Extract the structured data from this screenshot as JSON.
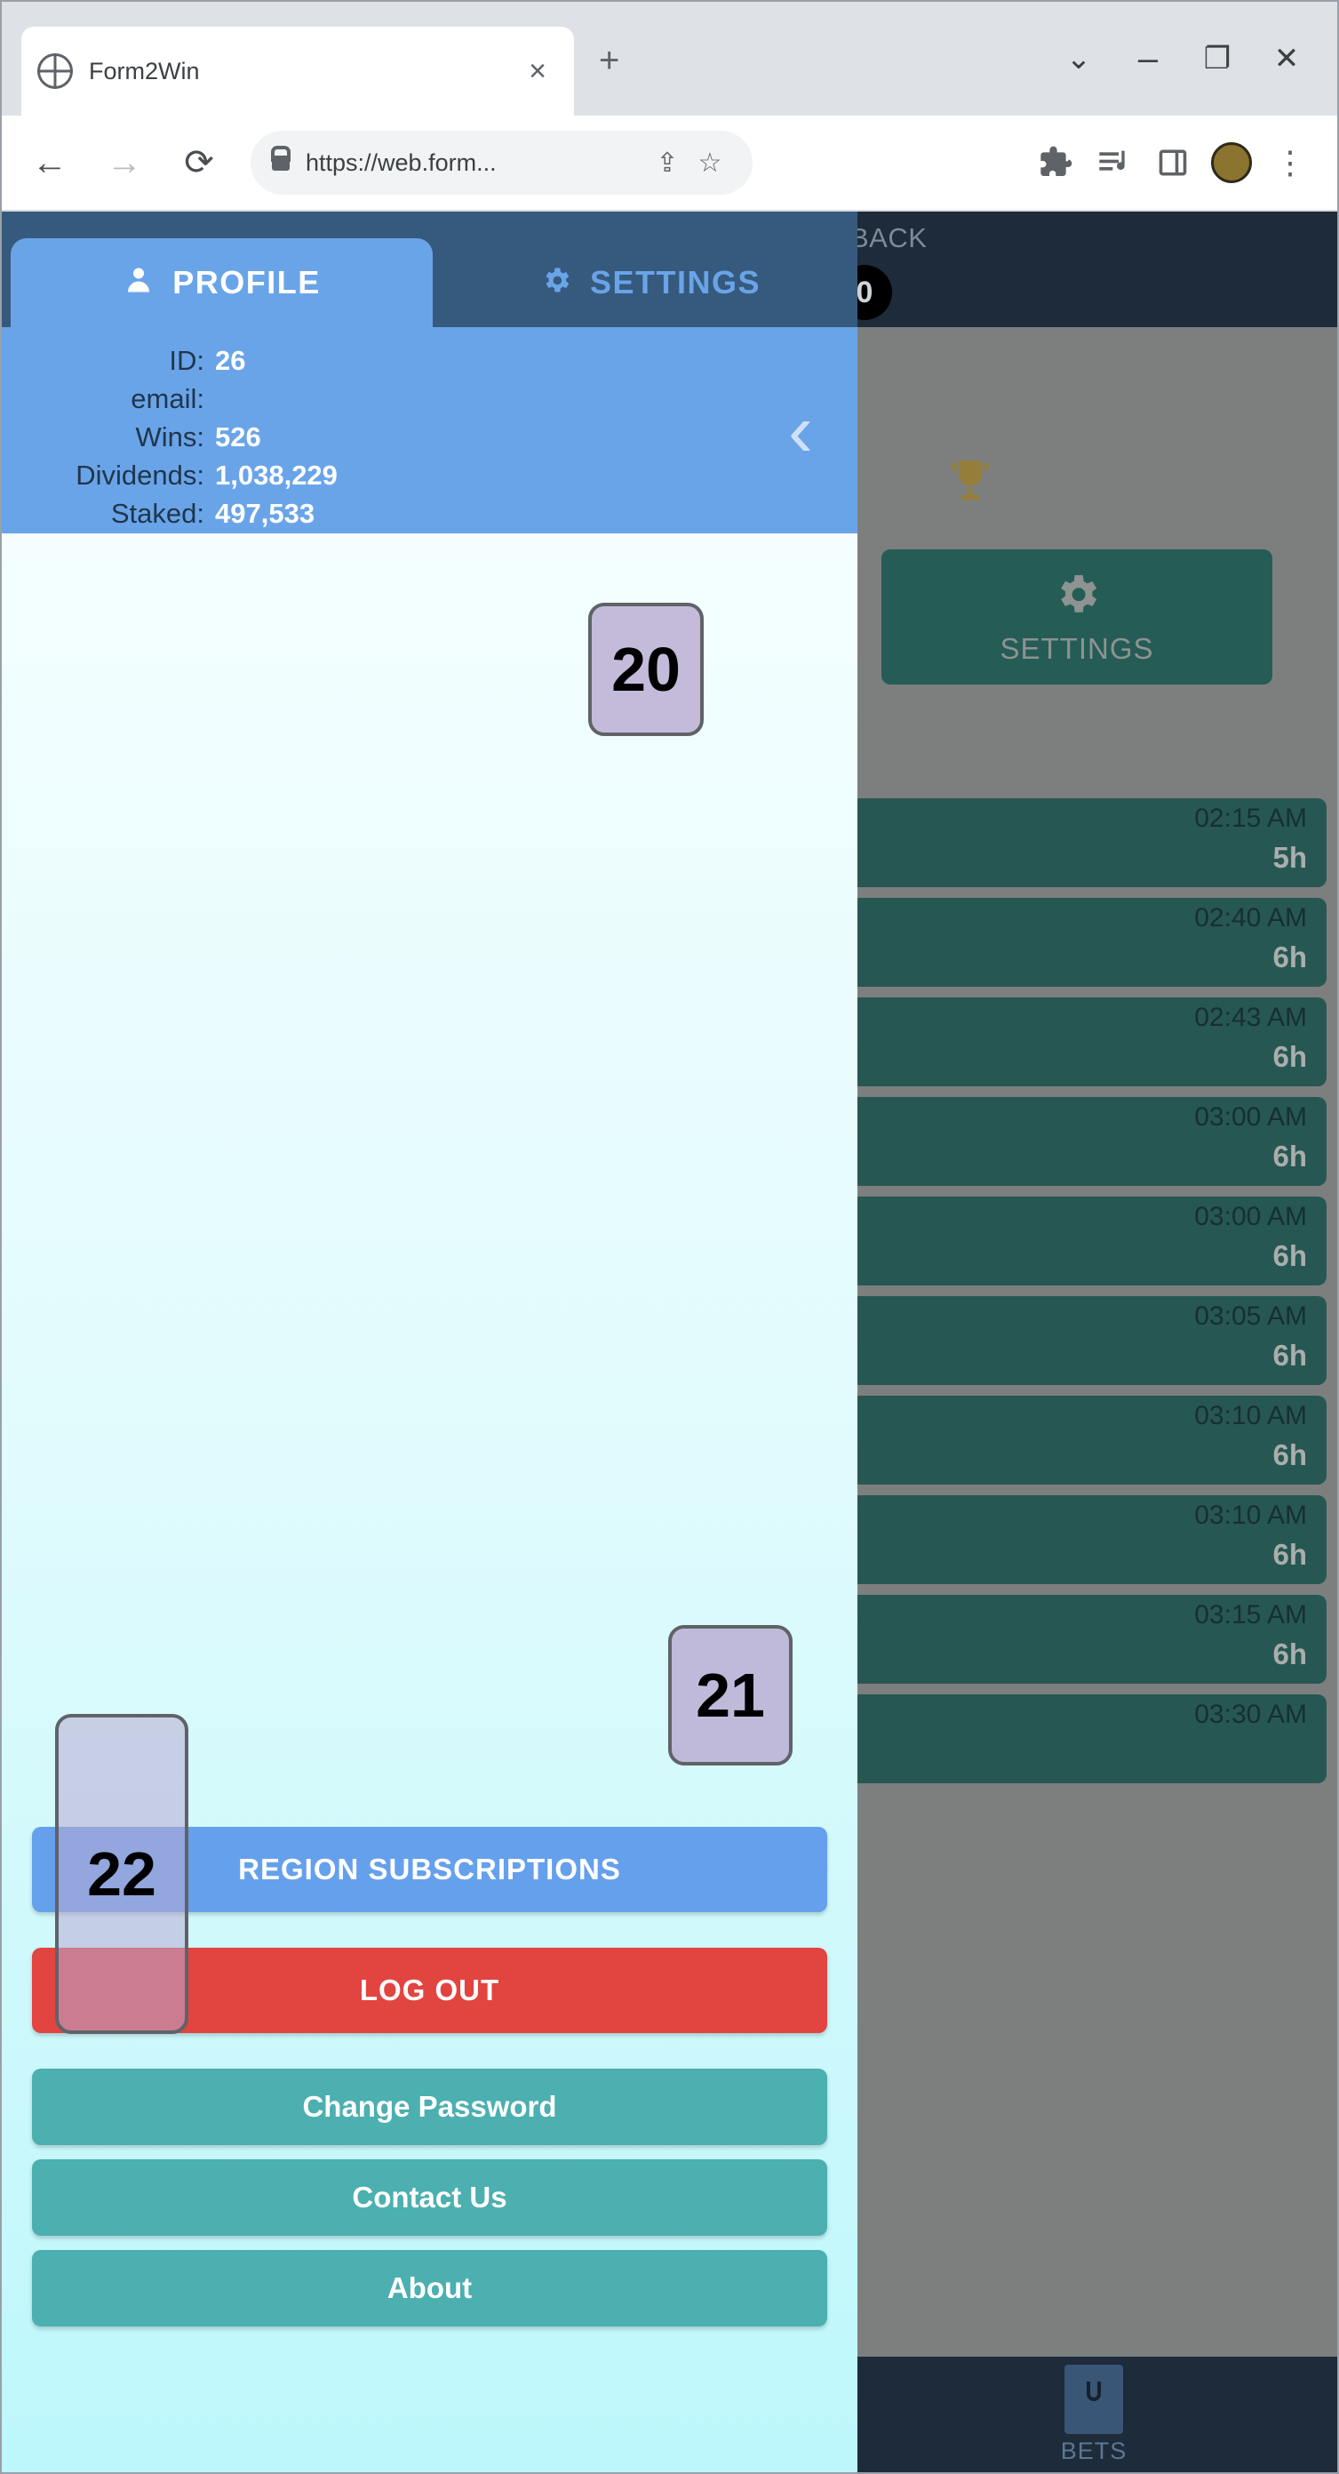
{
  "browser": {
    "tab": {
      "title": "Form2Win",
      "favicon_icon": "globe-icon",
      "close_icon": "×"
    },
    "new_tab_icon": "+",
    "window_controls": {
      "expand": "⌄",
      "minimize": "–",
      "maximize": "❐",
      "close": "✕"
    },
    "toolbar": {
      "back_icon": "←",
      "forward_icon": "→",
      "reload_icon": "⟳",
      "lock_icon": "lock-icon",
      "url": "https://web.form...",
      "share_icon": "⇪",
      "bookmark_icon": "☆",
      "extensions_icon": "🧩",
      "media_icon": "≡♪",
      "sidepanel_icon": "❑",
      "profile_icon": "avatar",
      "menu_icon": "⋮"
    }
  },
  "drawer": {
    "tabs": [
      {
        "label": "PROFILE",
        "icon": "person-icon",
        "active": true
      },
      {
        "label": "SETTINGS",
        "icon": "gear-icon",
        "active": false
      }
    ],
    "stats": [
      {
        "key": "ID:",
        "value": "26"
      },
      {
        "key": "email:",
        "value": ""
      },
      {
        "key": "Wins:",
        "value": "526"
      },
      {
        "key": "Dividends:",
        "value": "1,038,229"
      },
      {
        "key": "Staked:",
        "value": "497,533"
      }
    ],
    "back_chevron_icon": "‹",
    "actions": [
      {
        "label": "REGION SUBSCRIPTIONS",
        "style": "primary"
      },
      {
        "label": "LOG OUT",
        "style": "danger"
      },
      {
        "label": "Change Password",
        "style": "teal"
      },
      {
        "label": "Contact Us",
        "style": "teal"
      },
      {
        "label": "About",
        "style": "teal"
      }
    ]
  },
  "background": {
    "back_label": "BACK",
    "badge": "0",
    "trophy_icon": "trophy-icon",
    "settings_button": {
      "label": "SETTINGS",
      "icon": "gear-icon"
    },
    "rows": [
      {
        "time": "02:15 AM",
        "duration": "5h"
      },
      {
        "time": "02:40 AM",
        "duration": "6h"
      },
      {
        "time": "02:43 AM",
        "duration": "6h"
      },
      {
        "time": "03:00 AM",
        "duration": "6h"
      },
      {
        "time": "03:00 AM",
        "duration": "6h"
      },
      {
        "time": "03:05 AM",
        "duration": "6h"
      },
      {
        "time": "03:10 AM",
        "duration": "6h"
      },
      {
        "time": "03:10 AM",
        "duration": "6h"
      },
      {
        "time": "03:15 AM",
        "duration": "6h"
      },
      {
        "time": "03:30 AM",
        "duration": ""
      }
    ],
    "bottom_nav": [
      {
        "label": "BETS",
        "icon": "bet-ticket-icon"
      }
    ]
  },
  "markers": [
    {
      "id": "20",
      "label": "20"
    },
    {
      "id": "21",
      "label": "21"
    },
    {
      "id": "22",
      "label": "22"
    }
  ],
  "colors": {
    "drawer_header": "#365a7d",
    "accent_blue": "#6aa4e8",
    "danger_red": "#e24440",
    "teal": "#4cafb0",
    "app_dark": "#1d2b3a",
    "row_green": "#275752"
  }
}
